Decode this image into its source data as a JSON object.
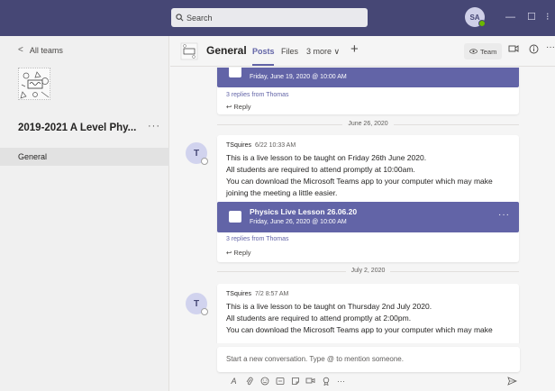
{
  "search": {
    "placeholder": "Search"
  },
  "user": {
    "initials": "SA"
  },
  "window": {
    "minimize": "—",
    "maximize": "☐",
    "more": "⁝"
  },
  "left": {
    "back_label": "All teams",
    "team_name": "2019-2021 A Level Phy...",
    "team_more": "···",
    "channel": "General"
  },
  "channel": {
    "title": "General",
    "tabs": [
      "Posts",
      "Files",
      "3 more ∨"
    ],
    "add": "+",
    "team_button": "Team",
    "more": "···"
  },
  "feed": {
    "top_card": {
      "meeting_time": "Friday, June 19, 2020 @ 10:00 AM",
      "replies": "3 replies from Thomas",
      "reply": "Reply"
    },
    "date1": "June 26, 2020",
    "post1": {
      "avatar": "T",
      "author": "TSquires",
      "time": "6/22 10:33 AM",
      "lines": [
        "This is a live lesson to be taught on Friday 26th June 2020.",
        "All students are required to attend promptly at 10:00am.",
        "You can download the Microsoft Teams app to your computer which may make",
        "joining the meeting a little easier."
      ],
      "meeting_title": "Physics Live Lesson 26.06.20",
      "meeting_time": "Friday, June 26, 2020 @ 10:00 AM",
      "meeting_more": "···",
      "replies": "3 replies from Thomas",
      "reply": "Reply"
    },
    "date2": "July 2, 2020",
    "post2": {
      "avatar": "T",
      "author": "TSquires",
      "time": "7/2 8:57 AM",
      "lines": [
        "This is a live lesson to be taught on Thursday 2nd July 2020.",
        "All students are required to attend promptly at 2:00pm.",
        "You can download the Microsoft Teams app to your computer which may make"
      ]
    }
  },
  "compose": {
    "placeholder": "Start a new conversation. Type @ to mention someone.",
    "more": "···"
  },
  "colors": {
    "titlebar": "#464775",
    "accent": "#6264a7",
    "presence": "#6bb700"
  }
}
